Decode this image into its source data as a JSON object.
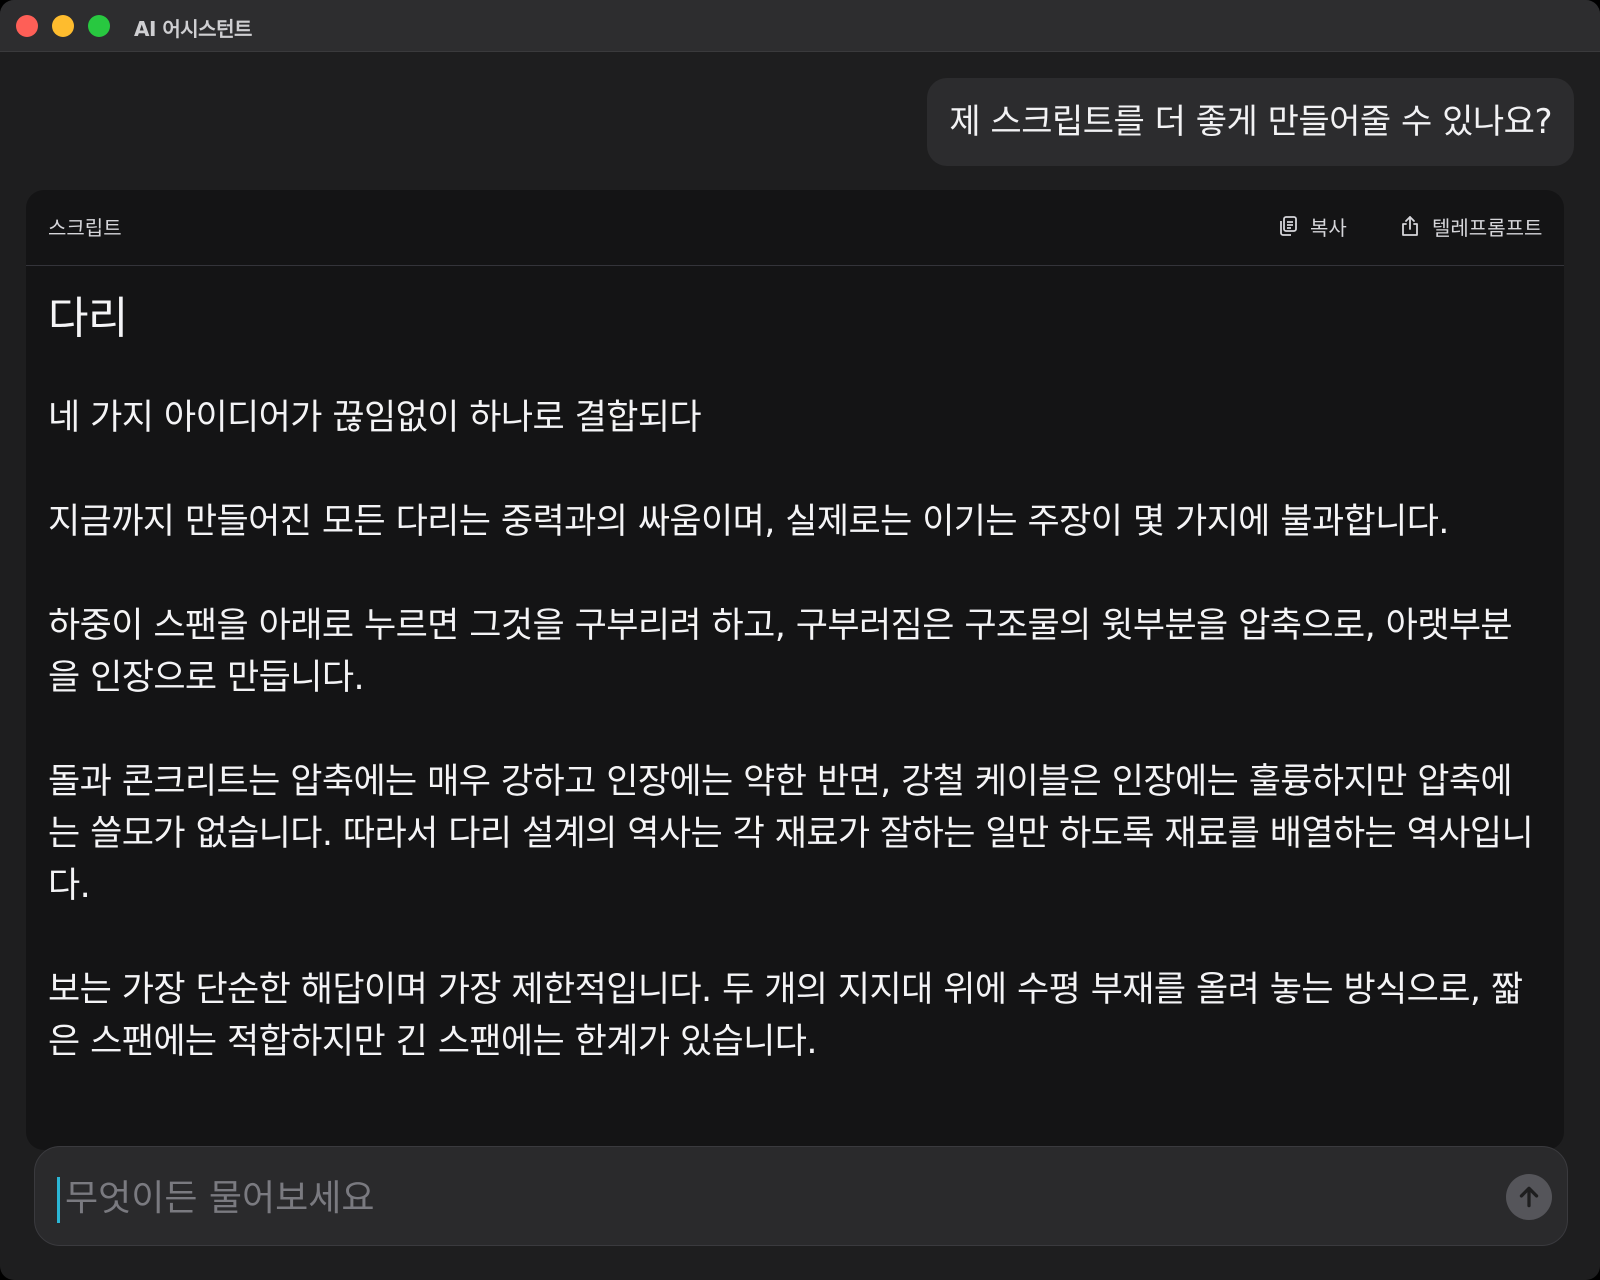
{
  "window": {
    "title": "AI 어시스턴트"
  },
  "chat": {
    "user_message": "제 스크립트를 더 좋게 만들어줄 수 있나요?"
  },
  "script_card": {
    "label": "스크립트",
    "actions": {
      "copy_label": "복사",
      "copy_icon": "copy-icon",
      "teleprompter_label": "텔레프롬프트",
      "teleprompter_icon": "share-icon"
    },
    "title": "다리",
    "paragraphs": [
      "네 가지 아이디어가 끊임없이 하나로 결합되다",
      "지금까지 만들어진 모든 다리는 중력과의 싸움이며, 실제로는 이기는 주장이 몇 가지에 불과합니다.",
      "하중이 스팬을 아래로 누르면 그것을 구부리려 하고, 구부러짐은 구조물의 윗부분을 압축으로, 아랫부분을 인장으로 만듭니다.",
      "돌과 콘크리트는 압축에는 매우 강하고 인장에는 약한 반면, 강철 케이블은 인장에는 훌륭하지만 압축에는 쓸모가 없습니다. 따라서 다리 설계의 역사는 각 재료가 잘하는 일만 하도록 재료를 배열하는 역사입니다.",
      "보는 가장 단순한 해답이며 가장 제한적입니다. 두 개의 지지대 위에 수평 부재를 올려 놓는 방식으로, 짧은 스팬에는 적합하지만 긴 스팬에는 한계가 있습니다."
    ]
  },
  "composer": {
    "placeholder": "무엇이든 물어보세요",
    "value": "",
    "send_icon": "arrow-up-icon"
  },
  "colors": {
    "window_bg": "#1e1e1f",
    "card_bg": "#141415",
    "bubble_bg": "#2c2c2e",
    "caret": "#2bb6d6"
  }
}
